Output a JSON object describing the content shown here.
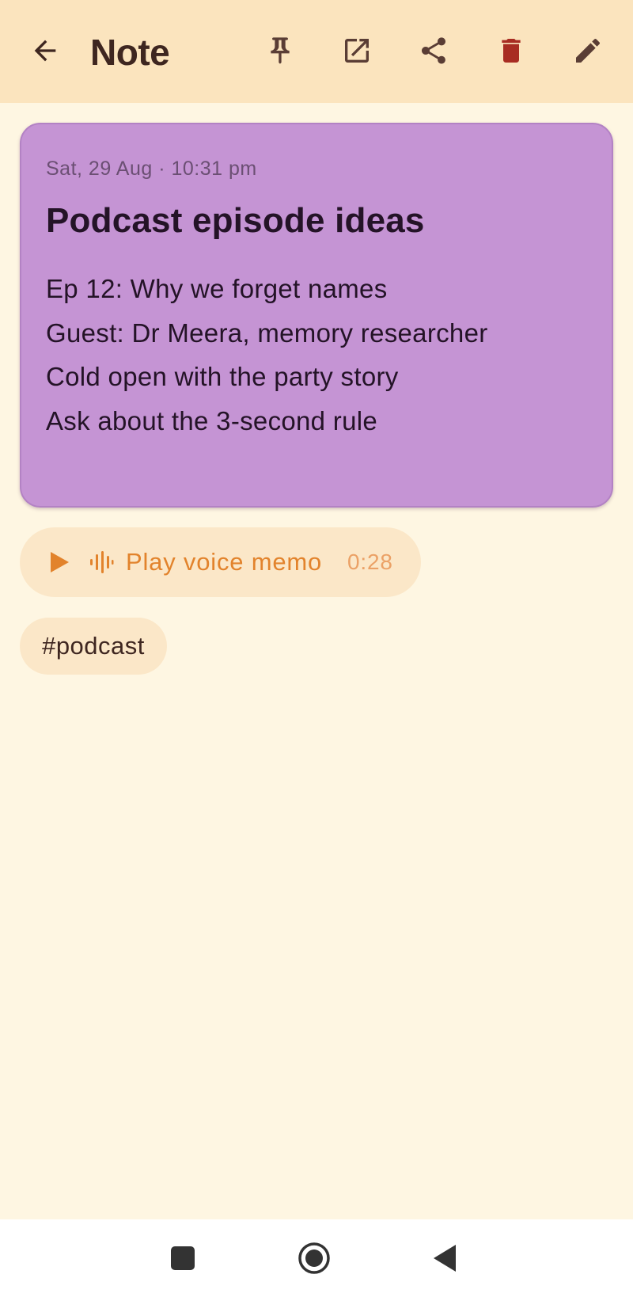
{
  "app_bar": {
    "title": "Note",
    "icons": {
      "back": "arrow-back-icon",
      "pin": "pin-icon",
      "open": "open-external-icon",
      "share": "share-icon",
      "delete": "delete-icon",
      "edit": "edit-pencil-icon"
    }
  },
  "note": {
    "date": "Sat, 29 Aug · 10:31 pm",
    "title": "Podcast episode ideas",
    "lines": [
      "Ep 12: Why we forget names",
      "Guest: Dr Meera, memory researcher",
      "Cold open with the party story",
      "Ask about the 3-second rule"
    ],
    "color": "#C594D4"
  },
  "voice_memo": {
    "label": "Play voice memo",
    "duration": "0:28",
    "icons": [
      "play-icon",
      "waveform-icon"
    ]
  },
  "tags": [
    "#podcast"
  ],
  "colors": {
    "background": "#FEF6E2",
    "app_bar": "#FBE4BE",
    "accent": "#E2832C",
    "delete": "#A82C22"
  },
  "nav_bar": {
    "icons": [
      "recents-square-icon",
      "home-circle-icon",
      "back-triangle-icon"
    ]
  }
}
